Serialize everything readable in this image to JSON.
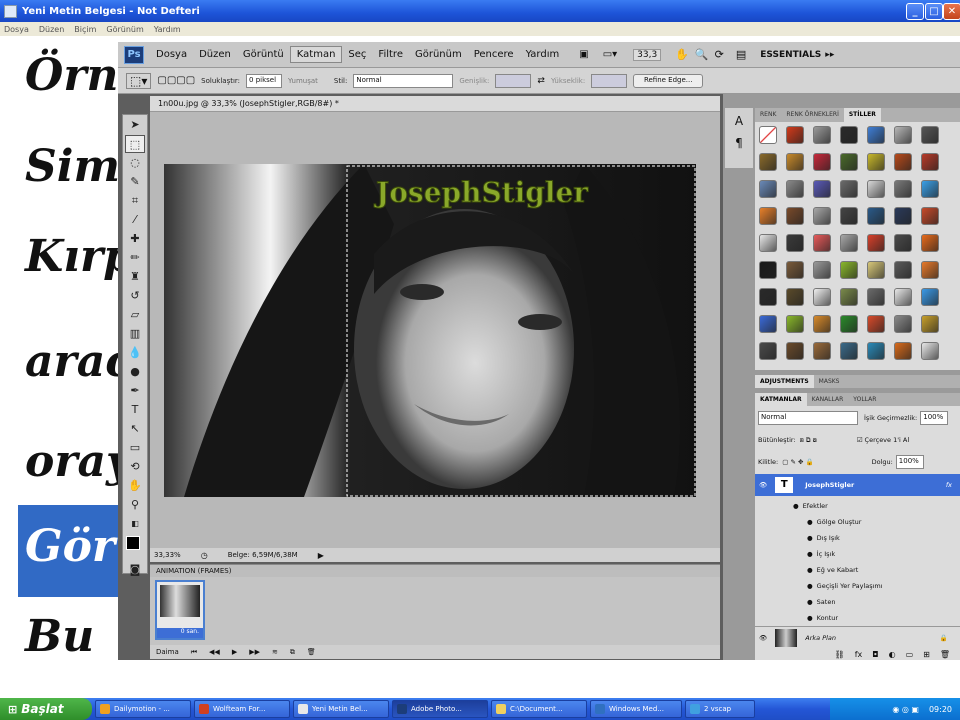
{
  "notepad": {
    "title": "Yeni Metin Belgesi - Not Defteri",
    "menu": [
      "Dosya",
      "Düzen",
      "Biçim",
      "Görünüm",
      "Yardım"
    ],
    "handwriting": [
      "Örn",
      "Sim",
      "Kırp",
      "arac",
      "oray",
      "Gör",
      "Bu"
    ]
  },
  "photoshop": {
    "menu": [
      "Dosya",
      "Düzen",
      "Görüntü",
      "Katman",
      "Seç",
      "Filtre",
      "Görünüm",
      "Pencere",
      "Yardım"
    ],
    "active_menu": "Katman",
    "zoom_display": "33,3",
    "workspace_label": "ESSENTIALS",
    "options": {
      "feather_label": "Soluklaştır:",
      "feather_value": "0 piksel",
      "antialias_label": "Yumuşat",
      "style_label": "Stil:",
      "style_value": "Normal",
      "width_label": "Genişlik:",
      "height_label": "Yükseklik:",
      "refine_button": "Refine Edge..."
    },
    "document_tab": "1n00u.jpg @ 33,3% (JosephStigler,RGB/8#) *",
    "watermark_text": "JosephStigler",
    "status": {
      "zoom": "33,33%",
      "doc_size": "Belge: 6,59M/6,38M"
    },
    "animation": {
      "header": "ANIMATION (FRAMES)",
      "frame_delay": "0 san.",
      "loop": "Daima"
    },
    "panels": {
      "swatch_tabs": [
        "RENK",
        "RENK ÖRNEKLERİ",
        "STİLLER"
      ],
      "swatch_tab_active": "STİLLER",
      "adjust_tabs": [
        "ADJUSTMENTS",
        "MASKS"
      ],
      "layer_tabs": [
        "KATMANLAR",
        "KANALLAR",
        "YOLLAR"
      ],
      "blend_mode": "Normal",
      "opacity_label": "İşik Geçirmezlik:",
      "opacity_value": "100%",
      "unify_label": "Bütünleştir:",
      "propagate_label": "Çerçeve 1'i Al",
      "lock_label": "Kilitle:",
      "fill_label": "Dolgu:",
      "fill_value": "100%",
      "layer_name": "JosephStigler",
      "layer_fx": "fx",
      "effects_label": "Efektler",
      "effects": [
        "Gölge Oluştur",
        "Dış Işık",
        "İç Işık",
        "Eğ ve Kabart",
        "Geçişli Yer Paylaşımı",
        "Saten",
        "Kontur"
      ],
      "background_layer": "Arka Plan",
      "swatch_colors": [
        "#ffffff",
        "#d43a1a",
        "#9a9a9a",
        "#2a2a2a",
        "#3f7fd6",
        "#b7b7b7",
        "#555555",
        "#8a6a2a",
        "#c88a2a",
        "#c8283a",
        "#4a6a2a",
        "#c8b82a",
        "#b84a1a",
        "#b83a28",
        "#6a8ab8",
        "#8a8a8a",
        "#5a5ab8",
        "#6a6a6a",
        "#d8d8d8",
        "#7a7a7a",
        "#3aa0e8",
        "#e8802a",
        "#7a4a2a",
        "#a8a8a8",
        "#444444",
        "#2a5a8a",
        "#2a3a5a",
        "#c84a2a",
        "#e8e8e8",
        "#3a3a3a",
        "#e85a5a",
        "#a8a8a8",
        "#d8402a",
        "#4a4a4a",
        "#e86a1a",
        "#1a1a1a",
        "#7a5a3a",
        "#9a9a9a",
        "#8ab82a",
        "#d8c87a",
        "#5a5a5a",
        "#e87a2a",
        "#2a2a2a",
        "#5a4a2a",
        "#f0f0f0",
        "#7a8a4a",
        "#6a6a6a",
        "#e8e8e8",
        "#3a9ae8",
        "#3a6ad8",
        "#8ab82a",
        "#d88a2a",
        "#2a8a2a",
        "#d84a2a",
        "#8a8a8a",
        "#c8a02a",
        "#4a4a4a",
        "#6a4a2a",
        "#9a6a3a",
        "#3a6a8a",
        "#2a8ab8",
        "#d86a1a",
        "#e8e8e8"
      ]
    }
  },
  "taskbar": {
    "start": "Başlat",
    "items": [
      "Dailymotion - ...",
      "Wolfteam For...",
      "Yeni Metin Bel...",
      "Adobe Photo...",
      "C:\\Document...",
      "Windows Med...",
      "2 vscap"
    ],
    "active_item": "Adobe Photo...",
    "clock": "09:20"
  }
}
